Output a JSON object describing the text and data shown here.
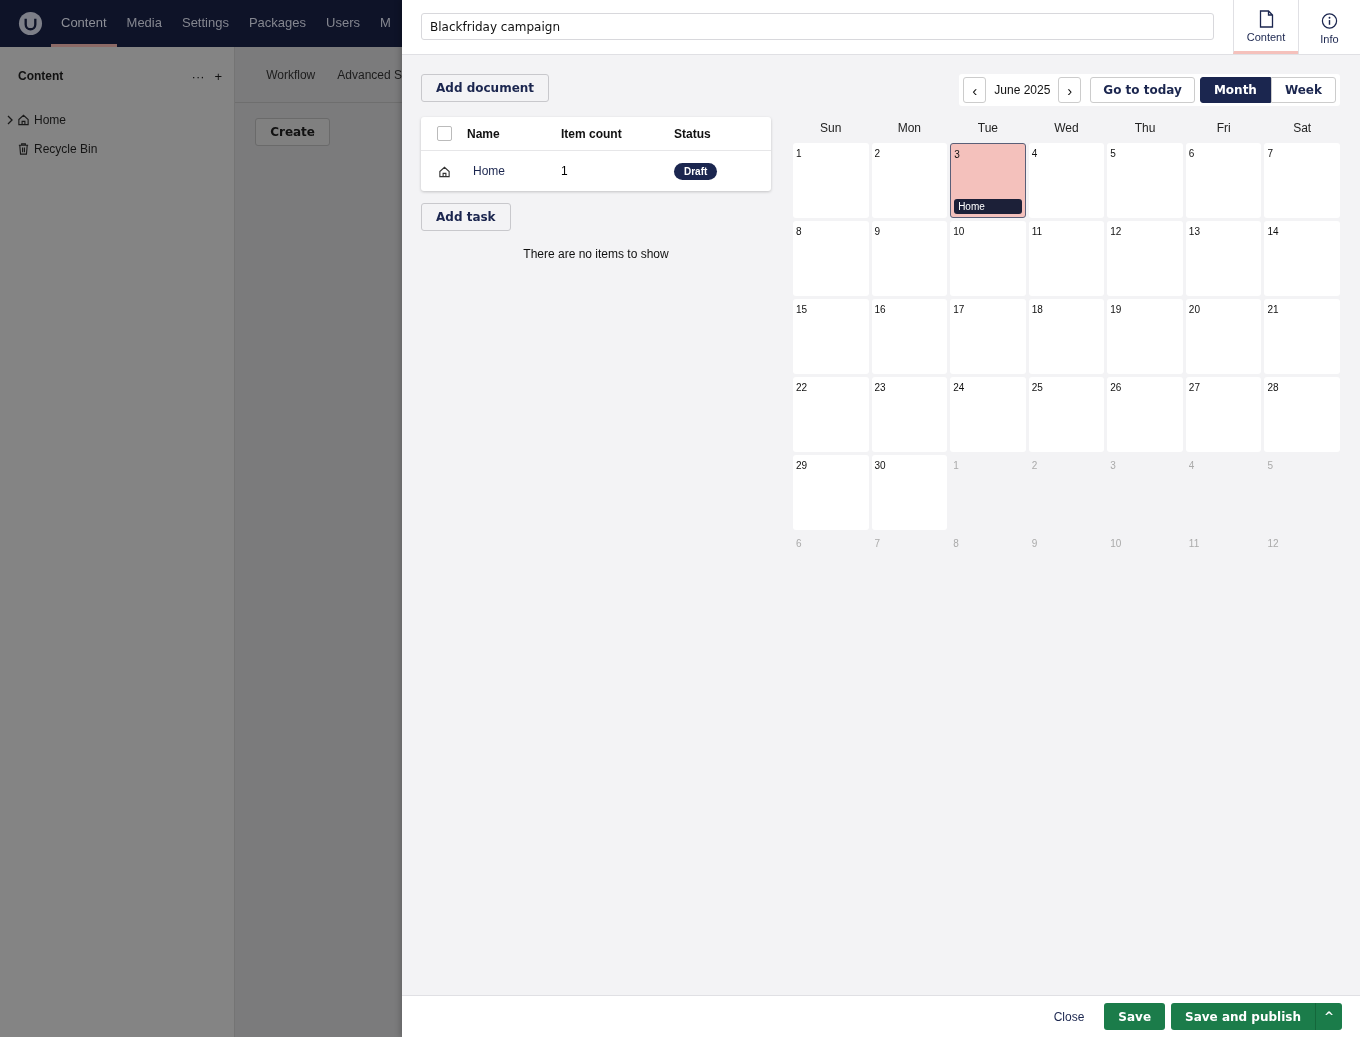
{
  "topnav": {
    "items": [
      {
        "label": "Content",
        "selected": true
      },
      {
        "label": "Media",
        "selected": false
      },
      {
        "label": "Settings",
        "selected": false
      },
      {
        "label": "Packages",
        "selected": false
      },
      {
        "label": "Users",
        "selected": false
      },
      {
        "label": "M",
        "selected": false
      }
    ]
  },
  "sidebar": {
    "title": "Content",
    "more": "···",
    "add": "+",
    "items": [
      {
        "label": "Home",
        "kind": "home",
        "expandable": true
      },
      {
        "label": "Recycle Bin",
        "kind": "bin",
        "expandable": false
      }
    ]
  },
  "workspace": {
    "tabs": [
      {
        "label": "Workflow"
      },
      {
        "label": "Advanced S"
      }
    ],
    "create": "Create"
  },
  "panel": {
    "name_value": "Blackfriday campaign",
    "apps": [
      {
        "label": "Content",
        "kind": "doc",
        "selected": true
      },
      {
        "label": "Info",
        "kind": "info",
        "selected": false
      }
    ],
    "add_document": "Add document",
    "table": {
      "select_all_checked": false,
      "columns": [
        "Name",
        "Item count",
        "Status"
      ],
      "rows": [
        {
          "name": "Home",
          "count": "1",
          "status": "Draft",
          "checked": false
        }
      ]
    },
    "add_task": "Add task",
    "empty": "There are no items to show",
    "calendar": {
      "prev": "‹",
      "month": "June 2025",
      "next": "›",
      "today_button": "Go to today",
      "views": [
        {
          "label": "Month",
          "selected": true
        },
        {
          "label": "Week",
          "selected": false
        }
      ],
      "weekdays": [
        "Sun",
        "Mon",
        "Tue",
        "Wed",
        "Thu",
        "Fri",
        "Sat"
      ],
      "weeks": [
        [
          {
            "day": "1",
            "in_month": true,
            "today": false
          },
          {
            "day": "2",
            "in_month": true,
            "today": false
          },
          {
            "day": "3",
            "in_month": true,
            "today": true,
            "event": "Home"
          },
          {
            "day": "4",
            "in_month": true,
            "today": false
          },
          {
            "day": "5",
            "in_month": true,
            "today": false
          },
          {
            "day": "6",
            "in_month": true,
            "today": false
          },
          {
            "day": "7",
            "in_month": true,
            "today": false
          }
        ],
        [
          {
            "day": "8",
            "in_month": true,
            "today": false
          },
          {
            "day": "9",
            "in_month": true,
            "today": false
          },
          {
            "day": "10",
            "in_month": true,
            "today": false
          },
          {
            "day": "11",
            "in_month": true,
            "today": false
          },
          {
            "day": "12",
            "in_month": true,
            "today": false
          },
          {
            "day": "13",
            "in_month": true,
            "today": false
          },
          {
            "day": "14",
            "in_month": true,
            "today": false
          }
        ],
        [
          {
            "day": "15",
            "in_month": true,
            "today": false
          },
          {
            "day": "16",
            "in_month": true,
            "today": false
          },
          {
            "day": "17",
            "in_month": true,
            "today": false
          },
          {
            "day": "18",
            "in_month": true,
            "today": false
          },
          {
            "day": "19",
            "in_month": true,
            "today": false
          },
          {
            "day": "20",
            "in_month": true,
            "today": false
          },
          {
            "day": "21",
            "in_month": true,
            "today": false
          }
        ],
        [
          {
            "day": "22",
            "in_month": true,
            "today": false
          },
          {
            "day": "23",
            "in_month": true,
            "today": false
          },
          {
            "day": "24",
            "in_month": true,
            "today": false
          },
          {
            "day": "25",
            "in_month": true,
            "today": false
          },
          {
            "day": "26",
            "in_month": true,
            "today": false
          },
          {
            "day": "27",
            "in_month": true,
            "today": false
          },
          {
            "day": "28",
            "in_month": true,
            "today": false
          }
        ],
        [
          {
            "day": "29",
            "in_month": true,
            "today": false
          },
          {
            "day": "30",
            "in_month": true,
            "today": false
          },
          {
            "day": "1",
            "in_month": false,
            "today": false
          },
          {
            "day": "2",
            "in_month": false,
            "today": false
          },
          {
            "day": "3",
            "in_month": false,
            "today": false
          },
          {
            "day": "4",
            "in_month": false,
            "today": false
          },
          {
            "day": "5",
            "in_month": false,
            "today": false
          }
        ],
        [
          {
            "day": "6",
            "in_month": false,
            "today": false
          },
          {
            "day": "7",
            "in_month": false,
            "today": false
          },
          {
            "day": "8",
            "in_month": false,
            "today": false
          },
          {
            "day": "9",
            "in_month": false,
            "today": false
          },
          {
            "day": "10",
            "in_month": false,
            "today": false
          },
          {
            "day": "11",
            "in_month": false,
            "today": false
          },
          {
            "day": "12",
            "in_month": false,
            "today": false
          }
        ]
      ]
    },
    "footer": {
      "close": "Close",
      "save": "Save",
      "publish": "Save and publish",
      "more": "^"
    }
  }
}
